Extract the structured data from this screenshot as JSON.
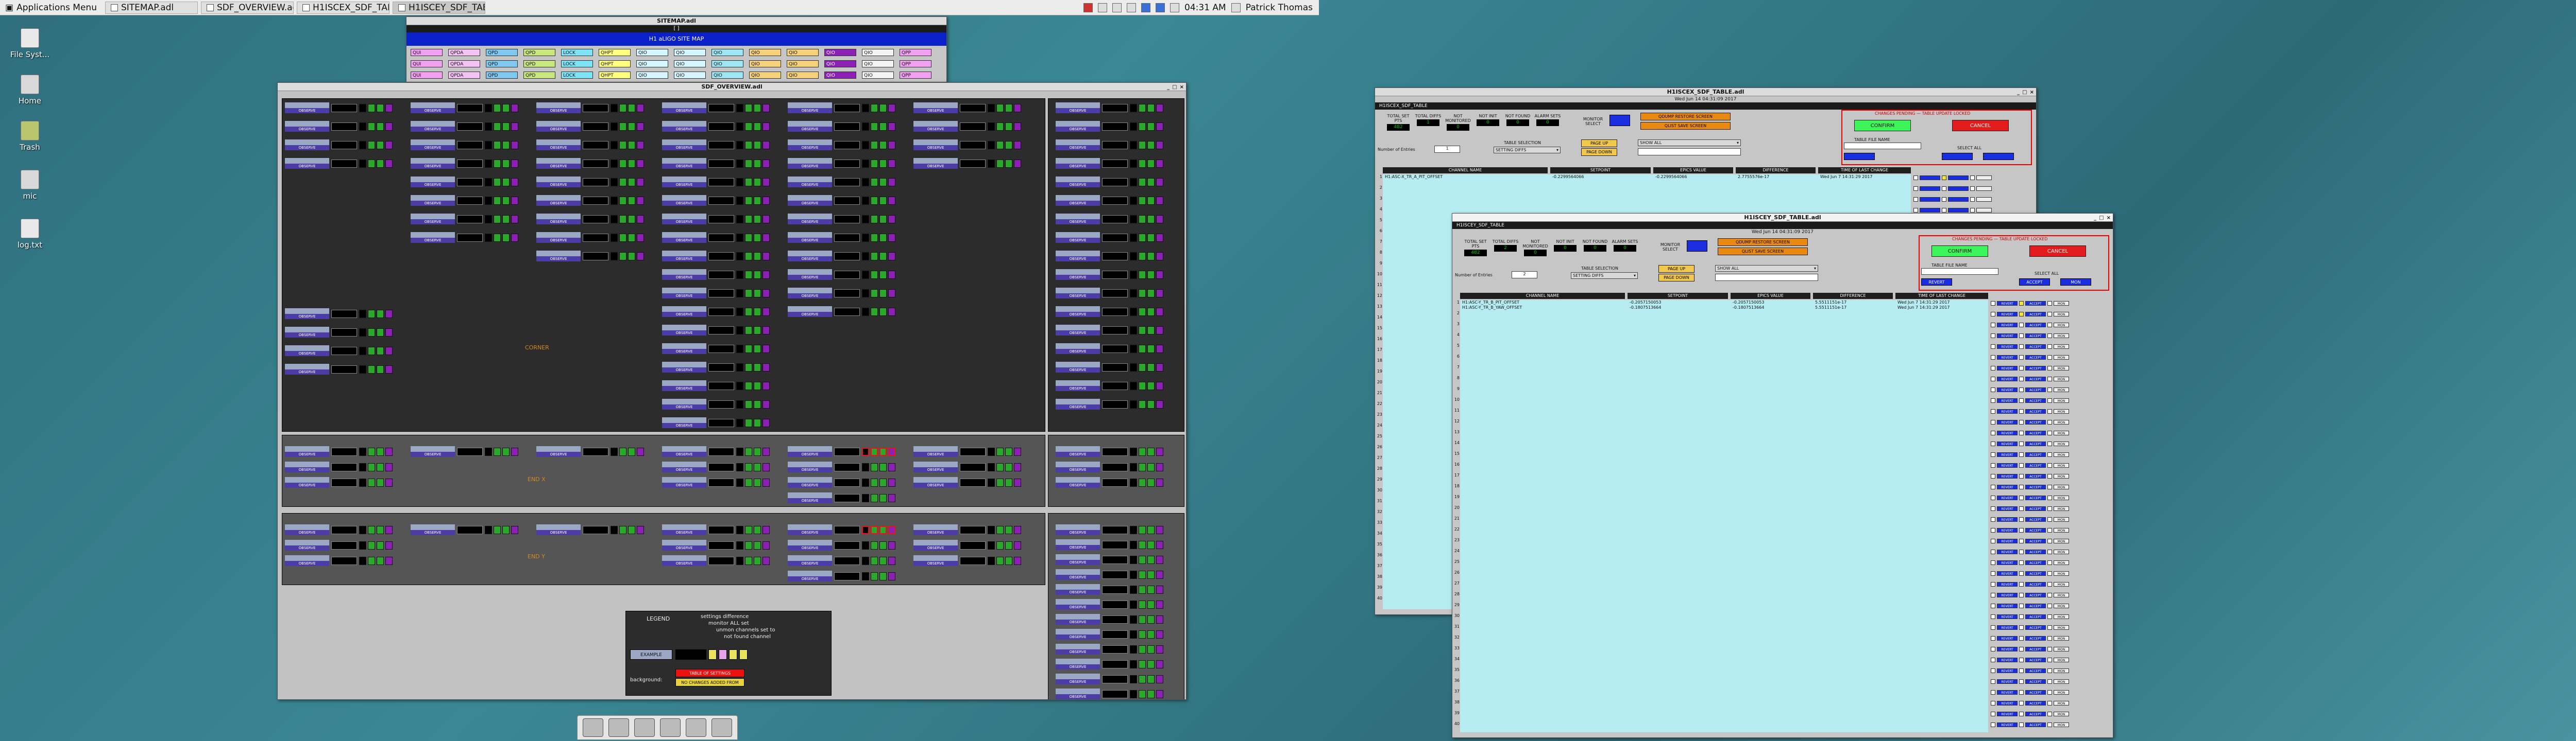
{
  "taskbar": {
    "apps_menu": "Applications Menu",
    "tasks": [
      "SITEMAP.adl",
      "SDF_OVERVIEW.adl",
      "H1ISCEX_SDF_TABLE...",
      "H1ISCEY_SDF_TABLE..."
    ],
    "time": "04:31 AM",
    "user": "Patrick Thomas"
  },
  "desktop_icons": [
    "File Syst...",
    "Home",
    "Trash",
    "mic",
    "log.txt"
  ],
  "sitemap": {
    "title": "SITEMAP.adl",
    "top_text": "[  ]",
    "banner": "H1 aLIGO SITE MAP",
    "buttons": [
      "QUI",
      "QPDA",
      "QPD",
      "QPD",
      "LOCK",
      "QHPT",
      "QIO",
      "QIO",
      "QIO",
      "QIO",
      "QIO",
      "QIO",
      "QIO",
      "QPP"
    ]
  },
  "overview": {
    "title": "SDF_OVERVIEW.adl",
    "center_label_1": "CORNER",
    "center_label_2": "END X",
    "center_label_3": "END Y",
    "legend_title": "LEGEND",
    "legend_notes": [
      "settings difference",
      "monitor ALL set",
      "unmon channels set to",
      "not found channel"
    ],
    "legend_example": "EXAMPLE",
    "legend_background": "background:",
    "legend_warn1": "TABLE OF SETTINGS",
    "legend_warn2": "NO CHANGES ADDED FROM",
    "row_label": "OBSERVE"
  },
  "tbl_x": {
    "title": "H1ISCEX_SDF_TABLE.adl",
    "header": "H1ISCEX_SDF_TABLE",
    "date": "Wed Jun 14 04:31:09 2017",
    "stats": [
      {
        "label": "TOTAL SET PTS",
        "value": "482"
      },
      {
        "label": "TOTAL DIFFS",
        "value": "1"
      },
      {
        "label": "NOT MONITORED",
        "value": "0"
      },
      {
        "label": "NOT INIT",
        "value": "0"
      },
      {
        "label": "NOT FOUND",
        "value": "0"
      },
      {
        "label": "ALARM SETS",
        "value": "0"
      }
    ],
    "monitor_select": "MONITOR SELECT",
    "qdump_restore": "QDUMP RESTORE SCREEN",
    "qlist_save": "QLIST SAVE SCREEN",
    "confirm": "CONFIRM",
    "cancel": "CANCEL",
    "changes_pending": "CHANGES PENDING — TABLE UPDATE LOCKED",
    "table_file_name": "TABLE FILE NAME",
    "select_all": "SELECT ALL",
    "table_selection": "TABLE SELECTION",
    "setting_diffs": "SETTING DIFFS",
    "show_all": "SHOW ALL",
    "num_entries_label": "Number of Entries",
    "num_entries": "1",
    "page_up": "PAGE UP",
    "page_down": "PAGE DOWN",
    "columns": [
      "CHANNEL NAME",
      "SETPOINT",
      "EPICS VALUE",
      "DIFFERENCE",
      "TIME OF LAST CHANGE"
    ],
    "rows": [
      {
        "name": "H1:ASC-X_TR_A_PIT_OFFSET",
        "setpoint": "-0.2299564066",
        "epics": "-0.2299564066",
        "diff": "2.7755576e-17",
        "time": "Wed Jun  7 14:31:29 2017"
      }
    ]
  },
  "tbl_y": {
    "title": "H1ISCEY_SDF_TABLE.adl",
    "header": "H1ISCEY_SDF_TABLE",
    "date": "Wed Jun 14 04:31:09 2017",
    "stats": [
      {
        "label": "TOTAL SET PTS",
        "value": "482"
      },
      {
        "label": "TOTAL DIFFS",
        "value": "2"
      },
      {
        "label": "NOT MONITORED",
        "value": "0"
      },
      {
        "label": "NOT INIT",
        "value": "0"
      },
      {
        "label": "NOT FOUND",
        "value": "0"
      },
      {
        "label": "ALARM SETS",
        "value": "0"
      }
    ],
    "monitor_select": "MONITOR SELECT",
    "qdump_restore": "QDUMP RESTORE SCREEN",
    "qlist_save": "QLIST SAVE SCREEN",
    "confirm": "CONFIRM",
    "cancel": "CANCEL",
    "changes_pending": "CHANGES PENDING — TABLE UPDATE LOCKED",
    "table_file_name": "TABLE FILE NAME",
    "select_all": "SELECT ALL",
    "table_selection": "TABLE SELECTION",
    "setting_diffs": "SETTING DIFFS",
    "show_all": "SHOW ALL",
    "num_entries_label": "Number of Entries",
    "num_entries": "2",
    "page_up": "PAGE UP",
    "page_down": "PAGE DOWN",
    "revert": "REVERT",
    "accept": "ACCEPT",
    "mon": "MON",
    "columns": [
      "CHANNEL NAME",
      "SETPOINT",
      "EPICS VALUE",
      "DIFFERENCE",
      "TIME OF LAST CHANGE"
    ],
    "rows": [
      {
        "name": "H1:ASC-Y_TR_B_PIT_OFFSET",
        "setpoint": "-0.2057150053",
        "epics": "-0.2057150053",
        "diff": "5.5511151e-17",
        "time": "Wed Jun  7 14:31:29 2017"
      },
      {
        "name": "H1:ASC-Y_TR_B_YAW_OFFSET",
        "setpoint": "-0.1807513664",
        "epics": "-0.1807513664",
        "diff": "5.5511151e-17",
        "time": "Wed Jun  7 14:31:29 2017"
      }
    ]
  }
}
